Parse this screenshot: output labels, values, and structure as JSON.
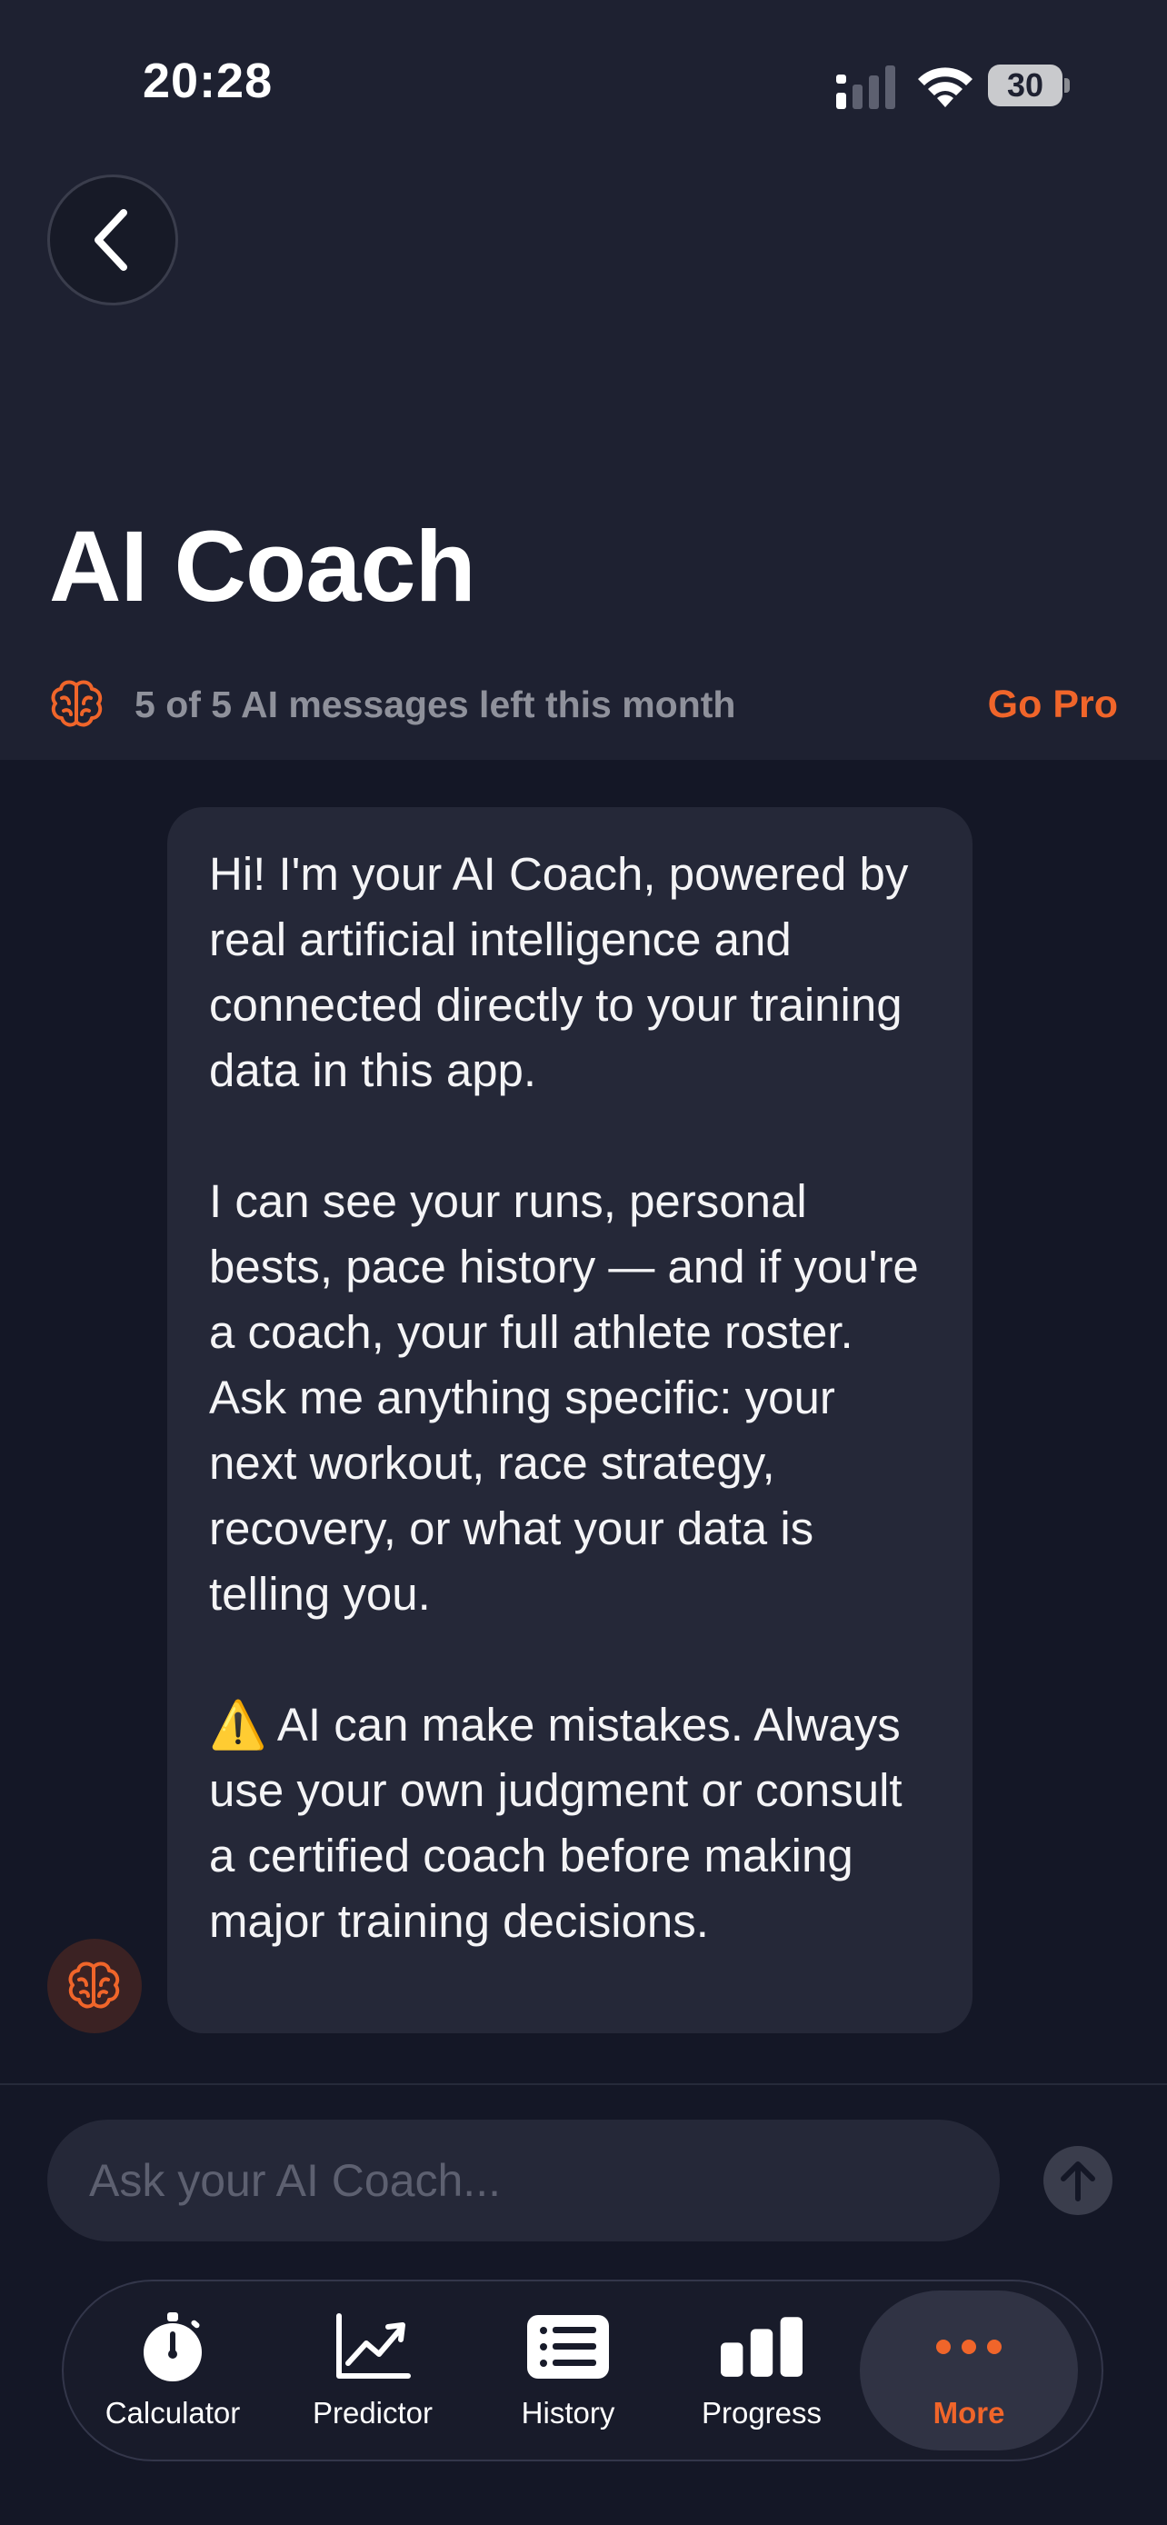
{
  "status_bar": {
    "time": "20:28",
    "battery": "30"
  },
  "header": {
    "back_icon": "chevron-left-icon",
    "title": "AI Coach",
    "quota_icon": "brain-icon",
    "quota_text": "5 of 5 AI messages left this month",
    "go_pro_label": "Go Pro"
  },
  "chat": {
    "messages": [
      {
        "sender": "AI Coach",
        "paragraphs": [
          "Hi! I'm your AI Coach, powered by real artificial intelligence and connected directly to your training data in this app.",
          "I can see your runs, personal bests, pace history — and if you're a coach, your full athlete roster. Ask me anything specific: your next workout, race strategy, recovery, or what your data is telling you.",
          "⚠️ AI can make mistakes. Always use your own judgment or consult a certified coach before making major training decisions."
        ]
      }
    ]
  },
  "composer": {
    "placeholder": "Ask your AI Coach...",
    "value": "",
    "send_icon": "arrow-up-icon"
  },
  "tabbar": {
    "tabs": [
      {
        "label": "Calculator",
        "icon": "stopwatch-icon",
        "active": false
      },
      {
        "label": "Predictor",
        "icon": "trend-chart-icon",
        "active": false
      },
      {
        "label": "History",
        "icon": "list-icon",
        "active": false
      },
      {
        "label": "Progress",
        "icon": "bar-chart-icon",
        "active": false
      },
      {
        "label": "More",
        "icon": "more-dots-icon",
        "active": true
      }
    ]
  },
  "colors": {
    "accent": "#f0652a",
    "background": "#141726",
    "header": "#1e2131",
    "bubble": "#252838"
  }
}
